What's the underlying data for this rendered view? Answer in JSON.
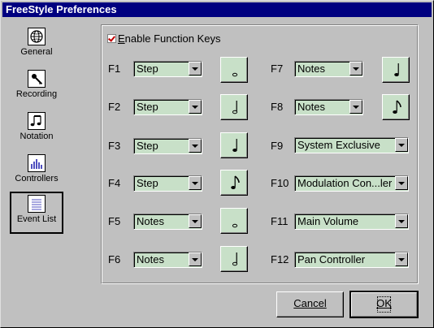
{
  "window": {
    "title": "FreeStyle Preferences"
  },
  "sidebar": {
    "items": [
      {
        "label": "General",
        "icon": "globe-icon"
      },
      {
        "label": "Recording",
        "icon": "microphone-icon"
      },
      {
        "label": "Notation",
        "icon": "music-notes-icon"
      },
      {
        "label": "Controllers",
        "icon": "controller-bars-icon"
      },
      {
        "label": "Event List",
        "icon": "list-icon",
        "selected": true
      }
    ]
  },
  "function_keys": {
    "enable_label": "Enable Function Keys",
    "enabled": true,
    "keys": [
      {
        "key": "F1",
        "value": "Step",
        "note": "half-note"
      },
      {
        "key": "F2",
        "value": "Step",
        "note": "quarter-note-hollow"
      },
      {
        "key": "F3",
        "value": "Step",
        "note": "quarter-note"
      },
      {
        "key": "F4",
        "value": "Step",
        "note": "eighth-note"
      },
      {
        "key": "F5",
        "value": "Notes",
        "note": "half-note"
      },
      {
        "key": "F6",
        "value": "Notes",
        "note": "quarter-note-hollow"
      },
      {
        "key": "F7",
        "value": "Notes",
        "note": "quarter-note"
      },
      {
        "key": "F8",
        "value": "Notes",
        "note": "eighth-note"
      },
      {
        "key": "F9",
        "value": "System Exclusive"
      },
      {
        "key": "F10",
        "value": "Modulation Con...ler"
      },
      {
        "key": "F11",
        "value": "Main Volume"
      },
      {
        "key": "F12",
        "value": "Pan Controller"
      }
    ]
  },
  "buttons": {
    "cancel": "Cancel",
    "ok": "OK"
  },
  "colors": {
    "title_bar": "#000080",
    "combo_fill": "#c8e0c8",
    "window_bg": "#c0c0c0"
  }
}
